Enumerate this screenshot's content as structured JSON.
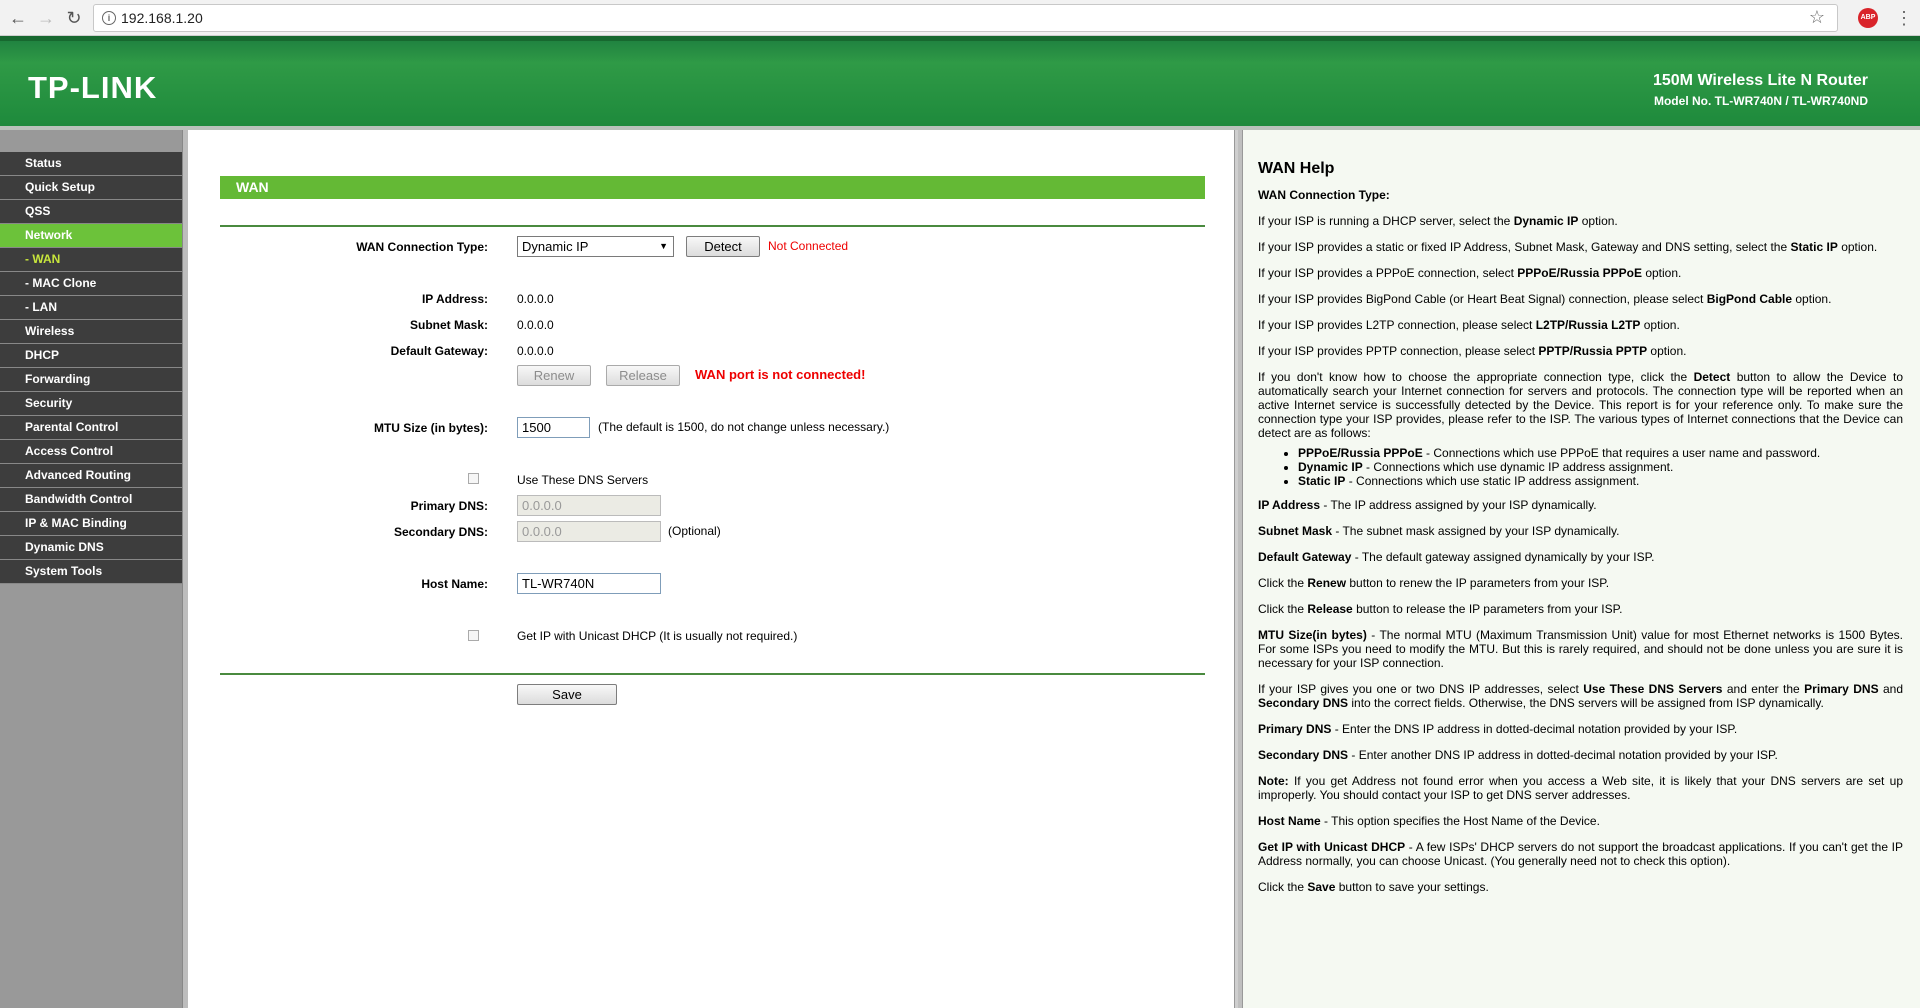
{
  "browser": {
    "url": "192.168.1.20"
  },
  "header": {
    "logo": "TP-LINK",
    "product": "150M Wireless Lite N Router",
    "model": "Model No. TL-WR740N / TL-WR740ND"
  },
  "menu": [
    {
      "label": "Status",
      "type": "main"
    },
    {
      "label": "Quick Setup",
      "type": "main"
    },
    {
      "label": "QSS",
      "type": "main"
    },
    {
      "label": "Network",
      "type": "active"
    },
    {
      "label": "- WAN",
      "type": "current"
    },
    {
      "label": "- MAC Clone",
      "type": "sub"
    },
    {
      "label": "- LAN",
      "type": "sub"
    },
    {
      "label": "Wireless",
      "type": "main"
    },
    {
      "label": "DHCP",
      "type": "main"
    },
    {
      "label": "Forwarding",
      "type": "main"
    },
    {
      "label": "Security",
      "type": "main"
    },
    {
      "label": "Parental Control",
      "type": "main"
    },
    {
      "label": "Access Control",
      "type": "main"
    },
    {
      "label": "Advanced Routing",
      "type": "main"
    },
    {
      "label": "Bandwidth Control",
      "type": "main"
    },
    {
      "label": "IP & MAC Binding",
      "type": "main"
    },
    {
      "label": "Dynamic DNS",
      "type": "main"
    },
    {
      "label": "System Tools",
      "type": "main"
    }
  ],
  "wan": {
    "title": "WAN",
    "conn_type_label": "WAN Connection Type:",
    "conn_type_value": "Dynamic IP",
    "detect_label": "Detect",
    "conn_status": "Not Connected",
    "ip_label": "IP Address:",
    "ip_value": "0.0.0.0",
    "mask_label": "Subnet Mask:",
    "mask_value": "0.0.0.0",
    "gateway_label": "Default Gateway:",
    "gateway_value": "0.0.0.0",
    "renew_label": "Renew",
    "release_label": "Release",
    "port_status": "WAN port is not connected!",
    "mtu_label": "MTU Size (in bytes):",
    "mtu_value": "1500",
    "mtu_note": "(The default is 1500, do not change unless necessary.)",
    "use_dns_label": "Use These DNS Servers",
    "primary_dns_label": "Primary DNS:",
    "primary_dns_value": "0.0.0.0",
    "secondary_dns_label": "Secondary DNS:",
    "secondary_dns_value": "0.0.0.0",
    "optional_note": "(Optional)",
    "host_label": "Host Name:",
    "host_value": "TL-WR740N",
    "unicast_label": "Get IP with Unicast DHCP (It is usually not required.)",
    "save_label": "Save"
  },
  "help": {
    "title": "WAN Help",
    "subtitle": "WAN Connection Type:",
    "p1a": "If your ISP is running a DHCP server, select the ",
    "p1b": "Dynamic IP",
    "p1c": " option.",
    "p2a": "If your ISP provides a static or fixed IP Address, Subnet Mask, Gateway and DNS setting, select the ",
    "p2b": "Static IP",
    "p2c": " option.",
    "p3a": "If your ISP provides a PPPoE connection, select ",
    "p3b": "PPPoE/Russia PPPoE",
    "p3c": " option.",
    "p4a": "If your ISP provides BigPond Cable (or Heart Beat Signal) connection, please select ",
    "p4b": "BigPond Cable",
    "p4c": " option.",
    "p5a": "If your ISP provides L2TP connection, please select ",
    "p5b": "L2TP/Russia L2TP",
    "p5c": " option.",
    "p6a": "If your ISP provides PPTP connection, please select ",
    "p6b": "PPTP/Russia PPTP",
    "p6c": " option.",
    "p7a": "If you don't know how to choose the appropriate connection type, click the ",
    "p7b": "Detect",
    "p7c": " button to allow the Device to automatically search your Internet connection for servers and protocols. The connection type will be reported when an active Internet service is successfully detected by the Device. This report is for your reference only. To make sure the connection type your ISP provides, please refer to the ISP. The various types of Internet connections that the Device can detect are as follows:",
    "li1a": "PPPoE/Russia PPPoE",
    "li1b": " - Connections which use PPPoE that requires a user name and password.",
    "li2a": "Dynamic IP",
    "li2b": " - Connections which use dynamic IP address assignment.",
    "li3a": "Static IP",
    "li3b": " - Connections which use static IP address assignment.",
    "p8a": "IP Address",
    "p8b": " - The IP address assigned by your ISP dynamically.",
    "p9a": "Subnet Mask",
    "p9b": " - The subnet mask assigned by your ISP dynamically.",
    "p10a": "Default Gateway",
    "p10b": " - The default gateway assigned dynamically by your ISP.",
    "p11a": "Click the ",
    "p11b": "Renew",
    "p11c": " button to renew the IP parameters from your ISP.",
    "p12a": "Click the ",
    "p12b": "Release",
    "p12c": " button to release the IP parameters from your ISP.",
    "p13a": "MTU Size(in bytes)",
    "p13b": " - The normal MTU (Maximum Transmission Unit) value for most Ethernet networks is 1500 Bytes. For some ISPs you need to modify the MTU. But this is rarely required, and should not be done unless you are sure it is necessary for your ISP connection.",
    "p14a": "If your ISP gives you one or two DNS IP addresses, select ",
    "p14b": "Use These DNS Servers",
    "p14c": " and enter the ",
    "p14d": "Primary DNS",
    "p14e": " and ",
    "p14f": "Secondary DNS",
    "p14g": " into the correct fields. Otherwise, the DNS servers will be assigned from ISP dynamically.",
    "p15a": "Primary DNS",
    "p15b": " - Enter the DNS IP address in dotted-decimal notation provided by your ISP.",
    "p16a": "Secondary DNS",
    "p16b": " - Enter another DNS IP address in dotted-decimal notation provided by your ISP.",
    "p17a": "Note:",
    "p17b": " If you get Address not found error when you access a Web site, it is likely that your DNS servers are set up improperly. You should contact your ISP to get DNS server addresses.",
    "p18a": "Host Name",
    "p18b": " - This option specifies the Host Name of the Device.",
    "p19a": "Get IP with Unicast DHCP",
    "p19b": " - A few ISPs' DHCP servers do not support the broadcast applications. If you can't get the IP Address normally, you can choose Unicast. (You generally need not to check this option).",
    "p20a": "Click the ",
    "p20b": "Save",
    "p20c": " button to save your settings."
  }
}
